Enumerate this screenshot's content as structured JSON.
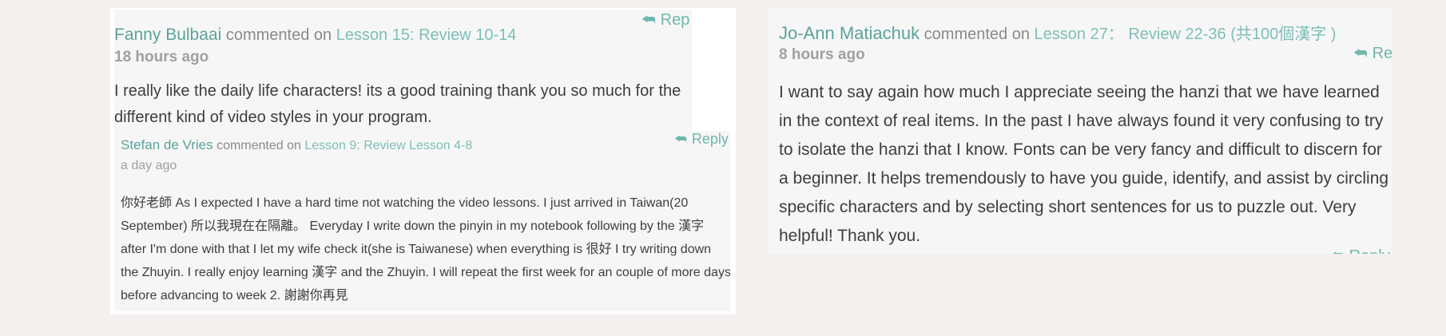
{
  "comments": {
    "fanny": {
      "author": "Fanny Bulbaai",
      "action": "commented on",
      "lesson": "Lesson 15: Review 10-14",
      "time": "18 hours ago",
      "text": "I really like the daily life characters! its a good training thank you so much for the different kind of video styles in your program.",
      "reply": "Rep"
    },
    "stefan": {
      "author": "Stefan de Vries",
      "action": "commented on",
      "lesson": "Lesson 9: Review Lesson 4-8",
      "time": "a day ago",
      "text": "你好老師 As I expected I have a hard time not watching the video lessons. I just arrived in Taiwan(20 September) 所以我現在在隔離。 Everyday I write down the pinyin in my notebook following by the 漢字 after I'm done with that I let my wife check it(she is Taiwanese) when everything is 很好 I try writing down the Zhuyin. I really enjoy learning 漢字 and the Zhuyin. I will repeat the first week for an couple of more days before advancing to week 2. 謝謝你再見",
      "reply": "Reply"
    },
    "jo": {
      "author": "Jo-Ann Matiachuk",
      "action": "commented on",
      "lesson": "Lesson 27： Review 22-36 (共100個漢字 )",
      "time": "8 hours ago",
      "text": "I want to say again how much I appreciate seeing the hanzi that we have learned in the context of real items. In the past I have always found it very confusing to try to isolate the hanzi that I know. Fonts can be very fancy and difficult to discern for a beginner. It helps tremendously to have you guide, identify, and assist by circling specific characters and by selecting short sentences for us to puzzle out. Very helpful! Thank you.",
      "reply": "Re",
      "reply2": "Reply"
    }
  },
  "icons": {
    "reply": "reply-arrow-icon"
  },
  "colors": {
    "author": "#5aa39b",
    "lesson": "#7cbfb8",
    "reply": "#6fb7ae",
    "background": "#f3f0ef"
  }
}
